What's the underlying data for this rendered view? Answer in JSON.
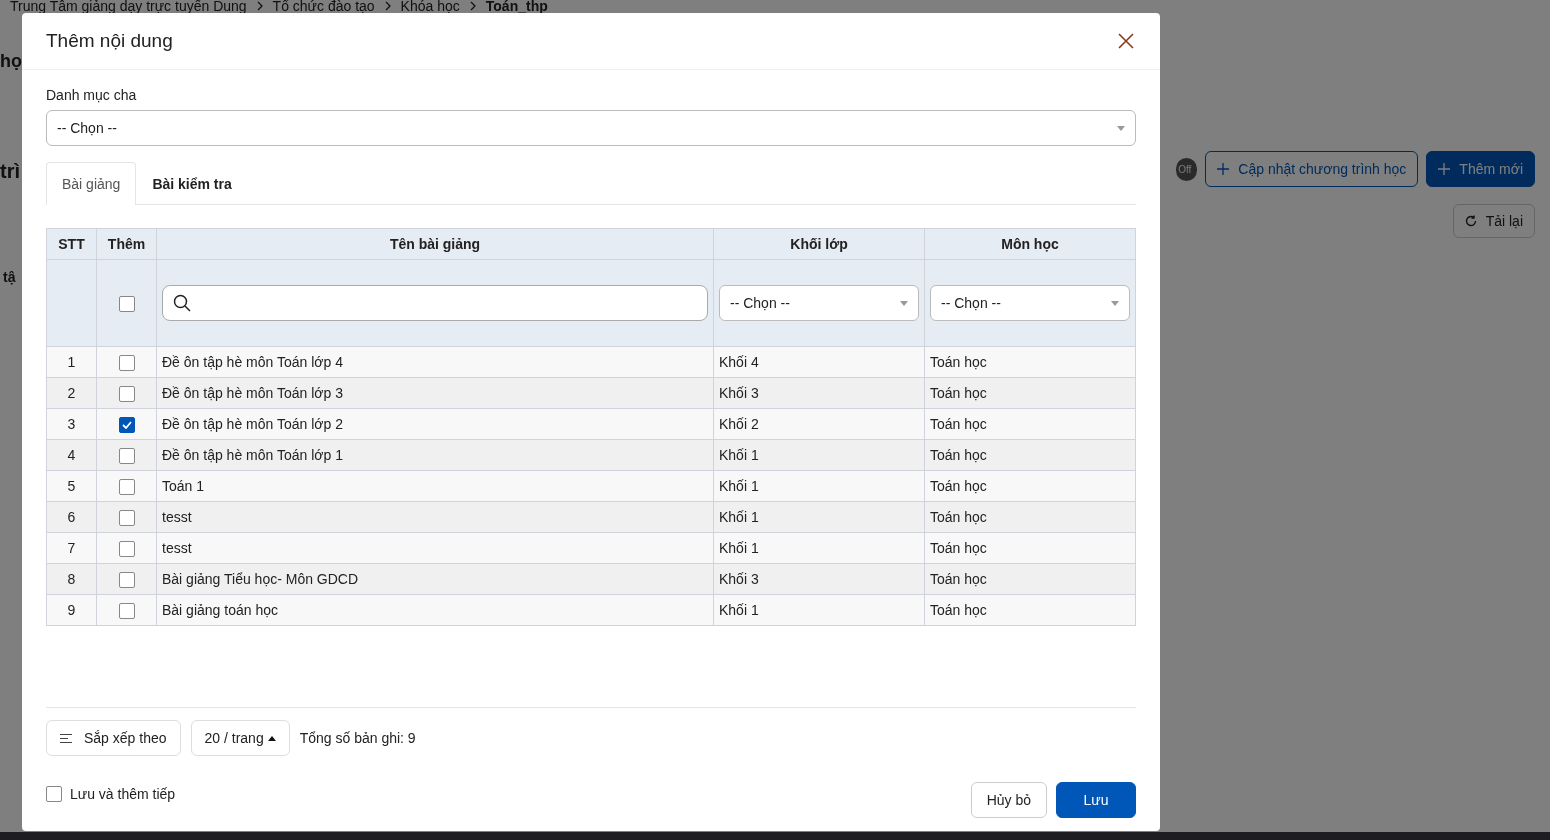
{
  "background": {
    "breadcrumb": [
      {
        "label": "Trung Tâm giảng dạy trực tuyến Dung",
        "current": false
      },
      {
        "label": "Tổ chức đào tạo",
        "current": false
      },
      {
        "label": "Khóa học",
        "current": false
      },
      {
        "label": "Toán_thp",
        "current": true
      }
    ],
    "fragments": [
      "họ",
      "trì",
      "tậ"
    ],
    "toggle": {
      "label": "Off",
      "on": false
    },
    "buttons": [
      {
        "label": "Cập nhật chương trình học",
        "kind": "outline"
      },
      {
        "label": "Thêm mới",
        "kind": "primary"
      }
    ],
    "reload_button": "Tải lại"
  },
  "dialog": {
    "title": "Thêm nội dung",
    "parent_category": {
      "label": "Danh mục cha",
      "value": "-- Chọn --"
    },
    "tabs": [
      {
        "label": "Bài giảng",
        "selected": true
      },
      {
        "label": "Bài kiểm tra",
        "selected": false
      }
    ],
    "table": {
      "columns": [
        "STT",
        "Thêm",
        "Tên bài giảng",
        "Khối lớp",
        "Môn học"
      ],
      "filters": {
        "select_all": false,
        "grade": "-- Chọn --",
        "subject": "-- Chọn --"
      },
      "rows": [
        {
          "stt": "1",
          "checked": false,
          "name": "Đề ôn tập hè môn Toán lớp 4",
          "grade": "Khối 4",
          "subject": "Toán học"
        },
        {
          "stt": "2",
          "checked": false,
          "name": "Đề ôn tập hè môn Toán lớp 3",
          "grade": "Khối 3",
          "subject": "Toán học"
        },
        {
          "stt": "3",
          "checked": true,
          "name": "Đề ôn tập hè môn Toán lớp 2",
          "grade": "Khối 2",
          "subject": "Toán học"
        },
        {
          "stt": "4",
          "checked": false,
          "name": "Đề ôn tập hè môn Toán lớp 1",
          "grade": "Khối 1",
          "subject": "Toán học"
        },
        {
          "stt": "5",
          "checked": false,
          "name": "Toán 1",
          "grade": "Khối 1",
          "subject": "Toán học"
        },
        {
          "stt": "6",
          "checked": false,
          "name": "tesst",
          "grade": "Khối 1",
          "subject": "Toán học"
        },
        {
          "stt": "7",
          "checked": false,
          "name": "tesst",
          "grade": "Khối 1",
          "subject": "Toán học"
        },
        {
          "stt": "8",
          "checked": false,
          "name": "Bài giảng Tiểu học- Môn GDCD",
          "grade": "Khối 3",
          "subject": "Toán học"
        },
        {
          "stt": "9",
          "checked": false,
          "name": "Bài giảng toán học",
          "grade": "Khối 1",
          "subject": "Toán học"
        }
      ]
    },
    "pagination": {
      "sort_button": "Sắp xếp theo",
      "page_size": "20 / trang",
      "total": "Tổng số bản ghi: 9"
    },
    "save_and_continue": {
      "label": "Lưu và thêm tiếp",
      "checked": false
    },
    "buttons": [
      {
        "label": "Hủy bỏ",
        "kind": "default"
      },
      {
        "label": "Lưu",
        "kind": "primary"
      }
    ]
  }
}
